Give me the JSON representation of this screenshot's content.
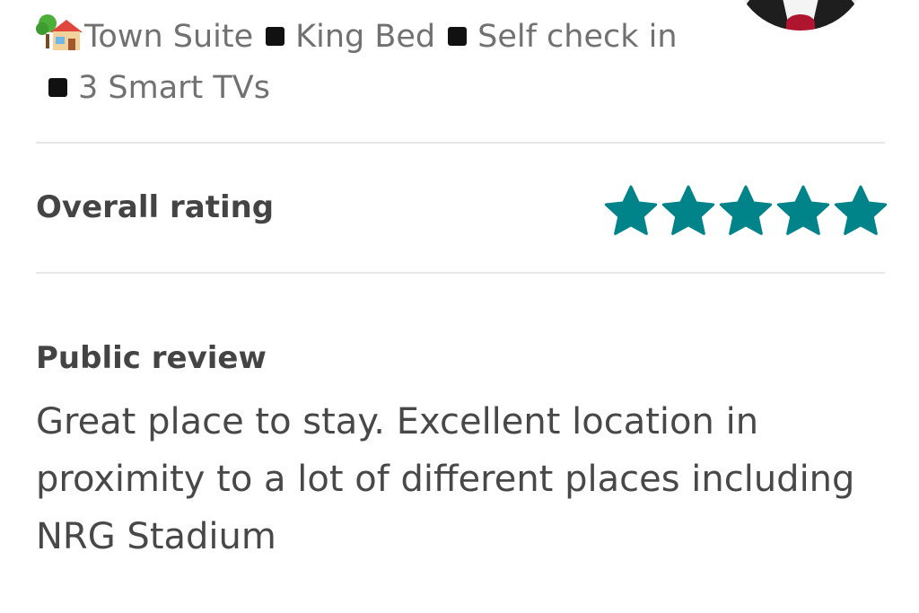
{
  "listing": {
    "title_fragment": ",",
    "title_emoji_icon": "house-with-garden-icon",
    "features": [
      "Town Suite",
      "King Bed",
      "Self check in",
      "3 Smart TVs"
    ],
    "separator_icon": "black-square-icon"
  },
  "host": {
    "avatar_icon": "host-avatar-photo"
  },
  "rating": {
    "label": "Overall rating",
    "stars": 5,
    "max_stars": 5,
    "star_color": "#008489"
  },
  "review": {
    "label": "Public review",
    "text": "Great place to stay. Excellent location in proximity to a lot of different places including NRG Stadium"
  },
  "colors": {
    "muted_text": "#717171",
    "heading_text": "#444444",
    "body_text": "#484848",
    "divider": "#e6e6e6",
    "accent": "#008489"
  }
}
